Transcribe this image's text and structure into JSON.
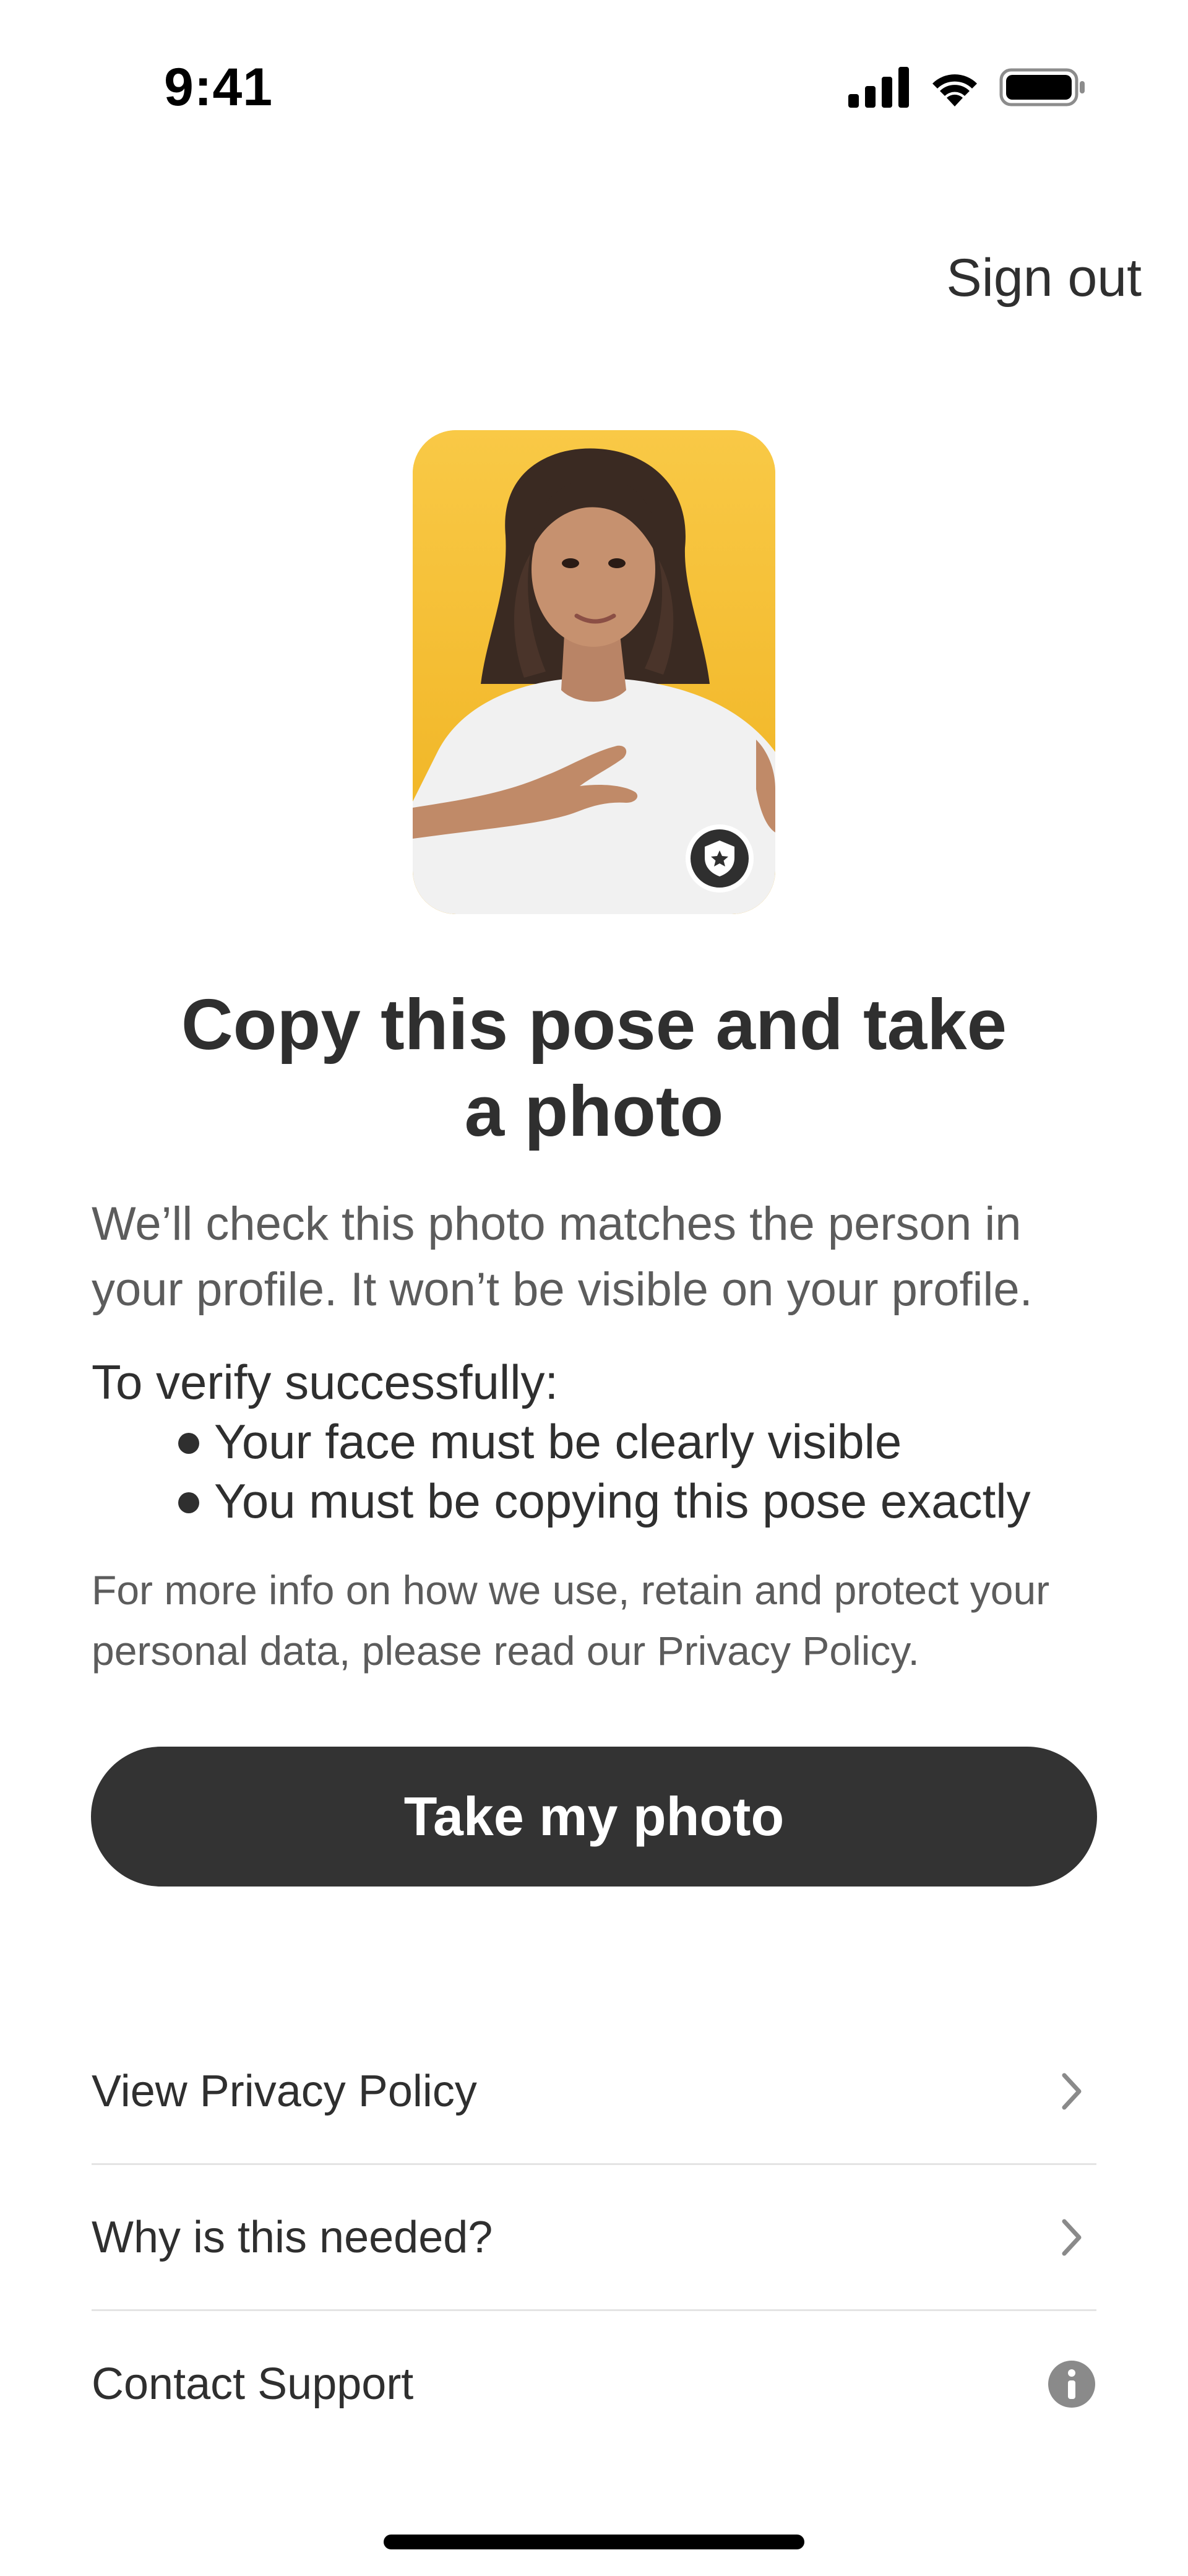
{
  "status_bar": {
    "time": "9:41"
  },
  "header": {
    "sign_out_label": "Sign out"
  },
  "pose": {
    "badge_icon": "shield-star-icon"
  },
  "content": {
    "headline_line1": "Copy this pose and take",
    "headline_line2": "a photo",
    "description": "We’ll check this photo matches the person in your profile. It won’t be visible on your profile.",
    "requirements_title": "To verify successfully:",
    "requirements": [
      "Your face must be clearly visible",
      "You must be copying this pose exactly"
    ],
    "privacy_note": "For more info on how we use, retain and protect your personal data, please read our Privacy Policy."
  },
  "primary_action": {
    "label": "Take my photo"
  },
  "links": [
    {
      "label": "View Privacy Policy",
      "icon": "chevron-right-icon"
    },
    {
      "label": "Why is this needed?",
      "icon": "chevron-right-icon"
    },
    {
      "label": "Contact Support",
      "icon": "info-icon"
    }
  ],
  "colors": {
    "button_bg": "#333333",
    "photo_bg": "#f5bd2d",
    "text_primary": "#2f2f2f",
    "text_secondary": "#5c5c5c"
  }
}
